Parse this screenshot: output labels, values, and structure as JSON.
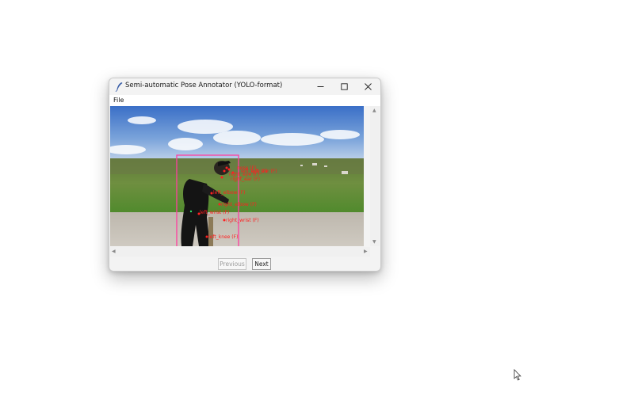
{
  "window": {
    "title": "Semi-automatic Pose Annotator (YOLO-format)",
    "controls": [
      "minimize-icon",
      "maximize-icon",
      "close-icon"
    ]
  },
  "menu": {
    "file_label": "File"
  },
  "canvas": {
    "keypoint_labels": [
      "nose (F)",
      "left_eye (F)",
      "right_eye (F)",
      "left_ear (F)",
      "right_ear (F)",
      "left_elbow (F)",
      "right_elbow (F)",
      "left_wrist (F)",
      "right_wrist (F)",
      "left_knee (F)"
    ],
    "label_color": "#ff2020",
    "bbox_color": "#ff3fa0"
  },
  "buttons": {
    "previous_label": "Previous",
    "next_label": "Next"
  },
  "icons": {
    "cursor": "mouse-pointer-icon",
    "app": "feather-icon"
  }
}
